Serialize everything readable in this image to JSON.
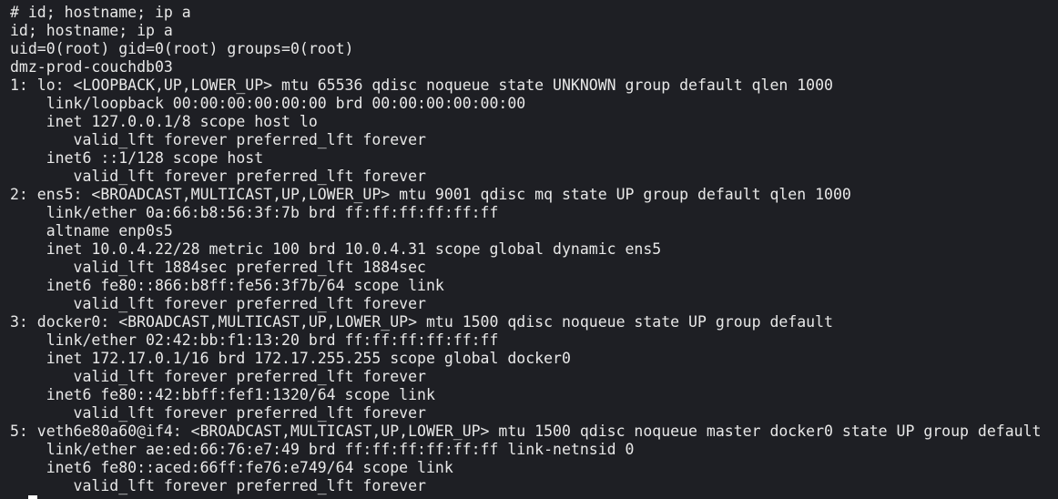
{
  "terminal": {
    "lines": [
      "# id; hostname; ip a",
      "id; hostname; ip a",
      "uid=0(root) gid=0(root) groups=0(root)",
      "dmz-prod-couchdb03",
      "1: lo: <LOOPBACK,UP,LOWER_UP> mtu 65536 qdisc noqueue state UNKNOWN group default qlen 1000",
      "    link/loopback 00:00:00:00:00:00 brd 00:00:00:00:00:00",
      "    inet 127.0.0.1/8 scope host lo",
      "       valid_lft forever preferred_lft forever",
      "    inet6 ::1/128 scope host",
      "       valid_lft forever preferred_lft forever",
      "2: ens5: <BROADCAST,MULTICAST,UP,LOWER_UP> mtu 9001 qdisc mq state UP group default qlen 1000",
      "    link/ether 0a:66:b8:56:3f:7b brd ff:ff:ff:ff:ff:ff",
      "    altname enp0s5",
      "    inet 10.0.4.22/28 metric 100 brd 10.0.4.31 scope global dynamic ens5",
      "       valid_lft 1884sec preferred_lft 1884sec",
      "    inet6 fe80::866:b8ff:fe56:3f7b/64 scope link",
      "       valid_lft forever preferred_lft forever",
      "3: docker0: <BROADCAST,MULTICAST,UP,LOWER_UP> mtu 1500 qdisc noqueue state UP group default",
      "    link/ether 02:42:bb:f1:13:20 brd ff:ff:ff:ff:ff:ff",
      "    inet 172.17.0.1/16 brd 172.17.255.255 scope global docker0",
      "       valid_lft forever preferred_lft forever",
      "    inet6 fe80::42:bbff:fef1:1320/64 scope link",
      "       valid_lft forever preferred_lft forever",
      "5: veth6e80a60@if4: <BROADCAST,MULTICAST,UP,LOWER_UP> mtu 1500 qdisc noqueue master docker0 state UP group default",
      "    link/ether ae:ed:66:76:e7:49 brd ff:ff:ff:ff:ff:ff link-netnsid 0",
      "    inet6 fe80::aced:66ff:fe76:e749/64 scope link",
      "       valid_lft forever preferred_lft forever"
    ]
  }
}
